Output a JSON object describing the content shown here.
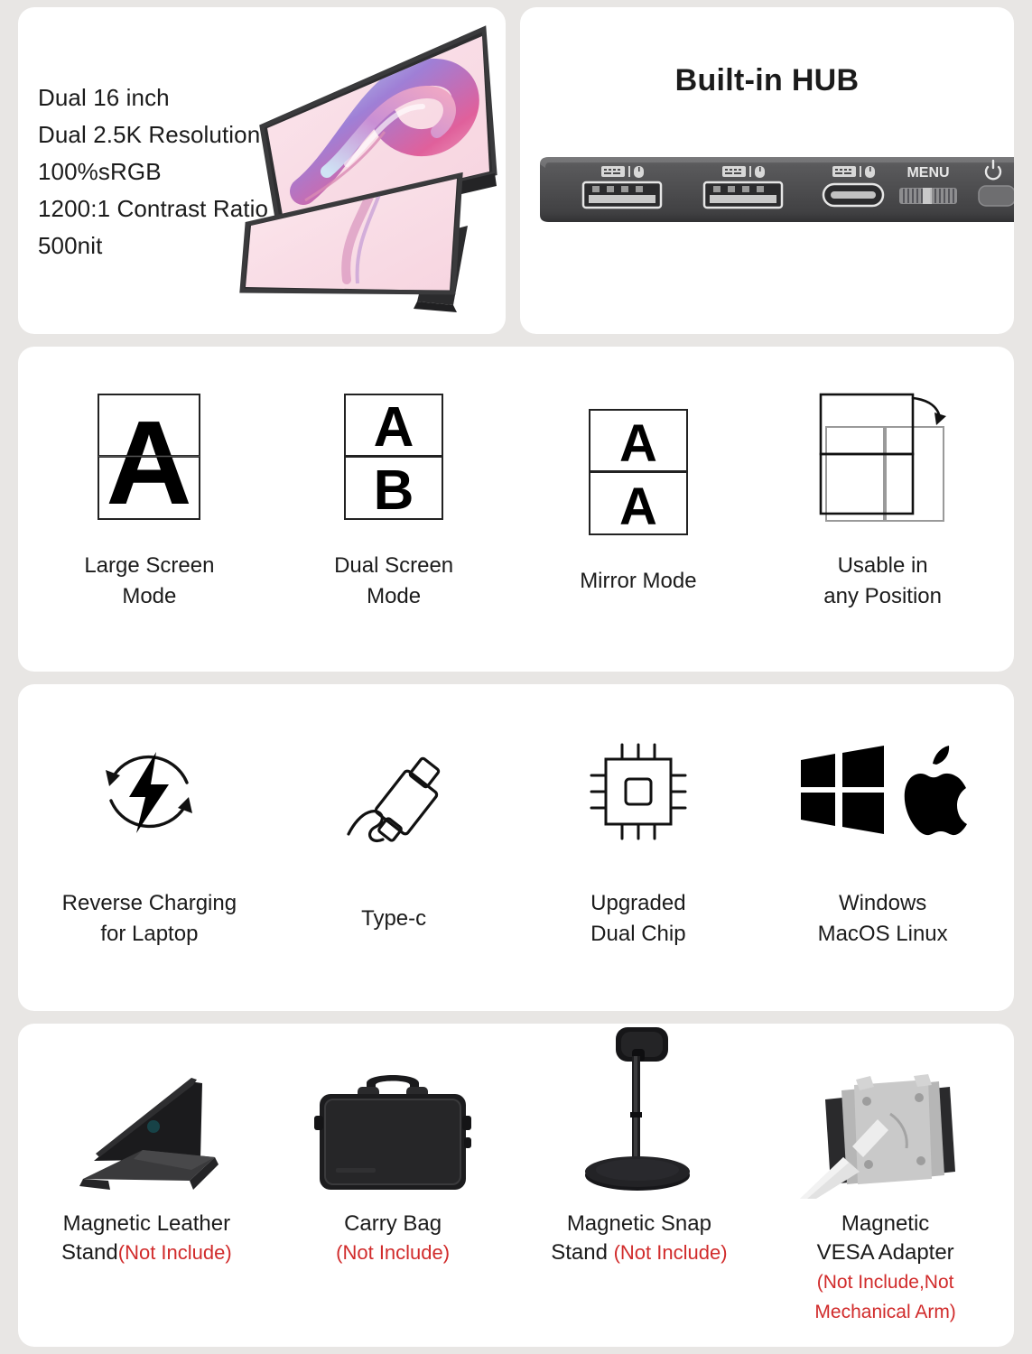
{
  "specs": {
    "items": [
      "Dual 16 inch",
      "Dual 2.5K Resolution",
      "100%sRGB",
      "1200:1 Contrast Ratio",
      "500nit"
    ],
    "product_image_alt": "dual-stacked-portable-monitor"
  },
  "hub": {
    "title": "Built-in HUB",
    "menu_label": "MENU",
    "ports": [
      {
        "type": "usb-a",
        "icon": "keyboard-mouse-icon"
      },
      {
        "type": "usb-a",
        "icon": "keyboard-mouse-icon"
      },
      {
        "type": "usb-c",
        "icon": "keyboard-mouse-icon"
      }
    ],
    "controls": [
      {
        "name": "menu-scroll-wheel",
        "label": "MENU"
      },
      {
        "name": "power-button",
        "label": "power-icon"
      }
    ]
  },
  "modes": [
    {
      "label": "Large Screen\nMode",
      "icon": "large-screen-mode-icon",
      "letters": [
        "A"
      ]
    },
    {
      "label": "Dual Screen\nMode",
      "icon": "dual-screen-mode-icon",
      "letters": [
        "A",
        "B"
      ]
    },
    {
      "label": "Mirror Mode",
      "icon": "mirror-mode-icon",
      "letters": [
        "A",
        "A"
      ]
    },
    {
      "label": "Usable in\nany Position",
      "icon": "any-position-icon",
      "letters": []
    }
  ],
  "features": [
    {
      "label": "Reverse Charging\nfor Laptop",
      "icon": "reverse-charging-icon"
    },
    {
      "label": "Type-c",
      "icon": "usb-c-cable-icon"
    },
    {
      "label": "Upgraded\nDual Chip",
      "icon": "chip-icon"
    },
    {
      "label": "Windows\nMacOS Linux",
      "icon": "windows-apple-icon"
    }
  ],
  "accessories": [
    {
      "name": "Magnetic Leather Stand",
      "name_line1": "Magnetic Leather",
      "name_line2": "Stand",
      "note": "(Not Include)",
      "note_inline": true,
      "image": "leather-stand-image"
    },
    {
      "name": "Carry Bag",
      "name_line1": "Carry Bag",
      "name_line2": "",
      "note": "(Not Include)",
      "note_inline": false,
      "image": "carry-bag-image"
    },
    {
      "name": "Magnetic Snap Stand",
      "name_line1": "Magnetic Snap",
      "name_line2": "Stand",
      "note": "(Not Include)",
      "note_inline": true,
      "image": "snap-stand-image"
    },
    {
      "name": "Magnetic VESA Adapter",
      "name_line1": "Magnetic",
      "name_line2": "VESA Adapter",
      "note_line1": "(Not Include,Not",
      "note_line2": "Mechanical Arm)",
      "note_inline": false,
      "image": "vesa-adapter-image"
    }
  ],
  "colors": {
    "page_background": "#e8e6e4",
    "card_background": "#ffffff",
    "text": "#1b1b1b",
    "note_red": "#d12b2b",
    "hub_body": "#4a4a4c"
  }
}
